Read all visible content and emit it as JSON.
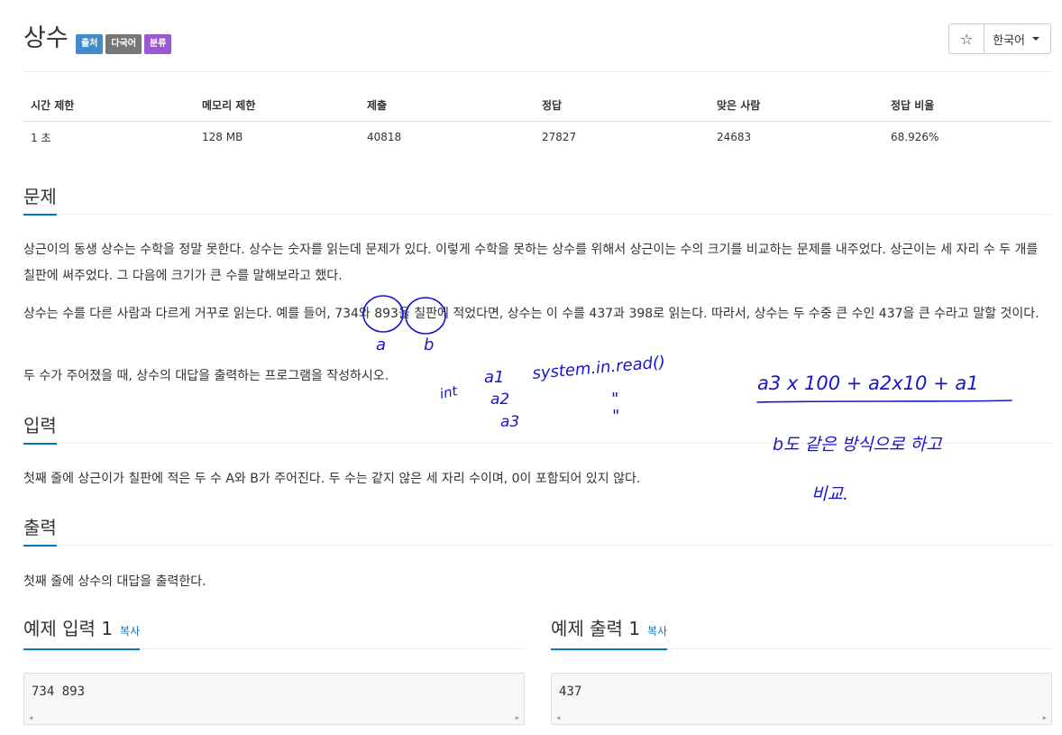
{
  "header": {
    "title": "상수",
    "labels": {
      "source": "출처",
      "multilang": "다국어",
      "category": "분류"
    },
    "star_icon": "☆",
    "language": "한국어"
  },
  "info_table": {
    "headers": [
      "시간 제한",
      "메모리 제한",
      "제출",
      "정답",
      "맞은 사람",
      "정답 비율"
    ],
    "values": [
      "1 초",
      "128 MB",
      "40818",
      "27827",
      "24683",
      "68.926%"
    ]
  },
  "problem": {
    "heading": "문제",
    "p1": "상근이의 동생 상수는 수학을 정말 못한다. 상수는 숫자를 읽는데 문제가 있다. 이렇게 수학을 못하는 상수를 위해서 상근이는 수의 크기를 비교하는 문제를 내주었다. 상근이는 세 자리 수 두 개를 칠판에 써주었다. 그 다음에 크기가 큰 수를 말해보라고 했다.",
    "p2": "상수는 수를 다른 사람과 다르게 거꾸로 읽는다. 예를 들어, 734와 893을 칠판에 적었다면, 상수는 이 수를 437과 398로 읽는다. 따라서, 상수는 두 수중 큰 수인 437을 큰 수라고 말할 것이다.",
    "p3": "두 수가 주어졌을 때, 상수의 대답을 출력하는 프로그램을 작성하시오."
  },
  "input": {
    "heading": "입력",
    "text": "첫째 줄에 상근이가 칠판에 적은 두 수 A와 B가 주어진다. 두 수는 같지 않은 세 자리 수이며, 0이 포함되어 있지 않다."
  },
  "output": {
    "heading": "출력",
    "text": "첫째 줄에 상수의 대답을 출력한다."
  },
  "samples": {
    "input_title": "예제 입력 1",
    "output_title": "예제 출력 1",
    "copy_label": "복사",
    "input_value": "734 893",
    "output_value": "437"
  },
  "annotations": {
    "a": "a",
    "b": "b",
    "int": "int",
    "a1": "a1",
    "a2": "a2",
    "a3": "a3",
    "system": "system.in.read()",
    "ditto1": "\"",
    "ditto2": "\"",
    "formula": "a3 x 100 + a2x10 + a1",
    "note1": "b도 같은 방식으로 하고",
    "note2": "비교."
  },
  "colors": {
    "ink": "#1a16c8",
    "accent": "#0076c0"
  }
}
